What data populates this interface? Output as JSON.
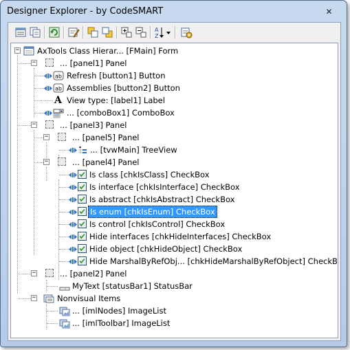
{
  "window": {
    "title": "Designer Explorer - by CodeSMART",
    "close_glyph": "✕"
  },
  "toolbar": {
    "buttons": [
      "properties-icon",
      "copy-icon",
      "refresh-icon",
      "edit-icon",
      "bring-front-icon",
      "send-back-icon",
      "expand-all-icon",
      "collapse-all-icon",
      "sort-icon",
      "settings-icon"
    ]
  },
  "tree": {
    "root": "AxTools Class Hierar... [FMain] Form",
    "panel1": "... [panel1] Panel",
    "button1": "Refresh [button1] Button",
    "button2": "Assemblies [button2] Button",
    "label1": "View type: [label1] Label",
    "combobox1": "... [comboBox1] ComboBox",
    "panel3": "... [panel3] Panel",
    "panel5": "... [panel5] Panel",
    "tvwmain": "... [tvwMain] TreeView",
    "panel4": "... [panel4] Panel",
    "chkisclass": "Is class [chkIsClass] CheckBox",
    "chkisinterface": "Is interface [chkIsInterface] CheckBox",
    "chkisabstract": "Is abstract [chkIsAbstract] CheckBox",
    "chkisenum": "Is enum [chkIsEnum] CheckBox",
    "chkiscontrol": "Is control [chkIsControl] CheckBox",
    "chkhideinterfaces": "Hide interfaces [chkHideInterfaces] CheckBox",
    "chkhideobject": "Hide object [chkHideObject] CheckBox",
    "chkhidemarshal": "Hide MarshalByRefObj... [chkHideMarshalByRefObject] CheckBox",
    "panel2": "... [panel2] Panel",
    "statusbar1": "MyText [statusBar1] StatusBar",
    "nonvisual": "Nonvisual Items",
    "imlnodes": "... [imlNodes] ImageList",
    "imltoolbar": "... [imlToolbar] ImageList",
    "expanded_glyph": "−",
    "label_icon_glyph": "A"
  },
  "colors": {
    "selection": "#3399ff",
    "check": "#2a9a2a",
    "anchor": "#2b6fcf"
  }
}
